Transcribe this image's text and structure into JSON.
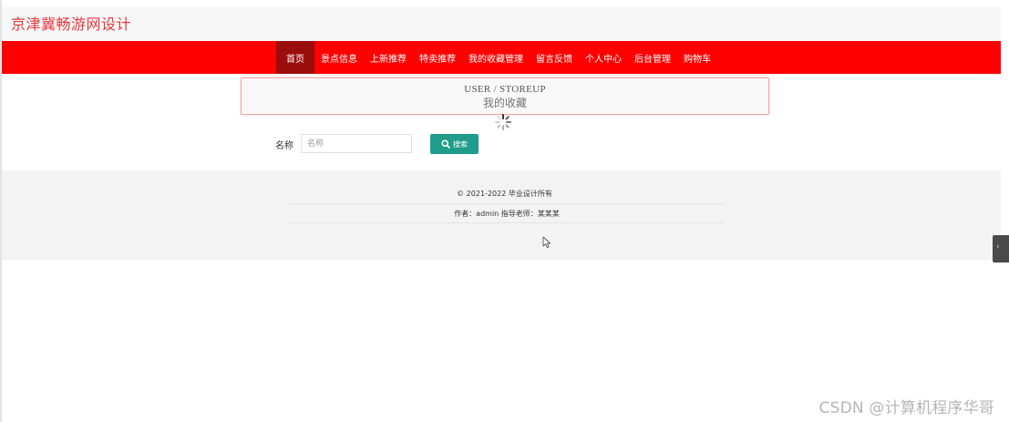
{
  "header": {
    "site_title": "京津冀畅游网设计"
  },
  "nav": {
    "items": [
      {
        "label": "首页",
        "active": true
      },
      {
        "label": "景点信息",
        "active": false
      },
      {
        "label": "上新推荐",
        "active": false
      },
      {
        "label": "特卖推荐",
        "active": false
      },
      {
        "label": "我的收藏管理",
        "active": false
      },
      {
        "label": "留言反馈",
        "active": false
      },
      {
        "label": "个人中心",
        "active": false
      },
      {
        "label": "后台管理",
        "active": false
      },
      {
        "label": "购物车",
        "active": false
      }
    ]
  },
  "breadcrumb": {
    "english": "USER / STOREUP",
    "chinese": "我的收藏"
  },
  "search": {
    "label": "名称",
    "placeholder": "名称",
    "button_label": "搜索"
  },
  "footer": {
    "copyright": "© 2021-2022 毕业设计所有",
    "author": "作者：admin 指导老师：某某某"
  },
  "watermark": "CSDN @计算机程序华哥",
  "colors": {
    "title_red": "#e4393c",
    "nav_red": "#ff0000",
    "nav_active": "#9b0d0d",
    "search_button": "#1f9d8a"
  },
  "icons": {
    "search_button_icon": "search-icon",
    "loading_icon": "loading-spinner-icon",
    "cursor_icon": "mouse-cursor-icon"
  }
}
